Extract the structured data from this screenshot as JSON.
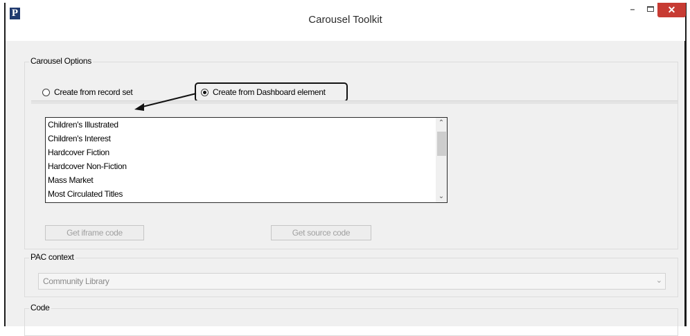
{
  "window": {
    "app_icon_letter": "P",
    "title": "Carousel Toolkit",
    "minimize_glyph": "–",
    "close_glyph": "✕"
  },
  "carousel_options": {
    "group_title": "Carousel Options",
    "radio_record_set": {
      "label": "Create from record set",
      "checked": false
    },
    "radio_dashboard": {
      "label": "Create from Dashboard element",
      "checked": true
    },
    "list_items": [
      "Children's Illustrated",
      "Children's Interest",
      "Hardcover Fiction",
      "Hardcover Non-Fiction",
      "Mass Market",
      "Most Circulated Titles"
    ],
    "get_iframe_label": "Get iframe code",
    "get_source_label": "Get source code"
  },
  "pac_context": {
    "group_title": "PAC context",
    "selected_value": "Community Library"
  },
  "code": {
    "group_title": "Code"
  },
  "colors": {
    "close_button": "#c73b33",
    "window_background": "#f0f0f0",
    "annotation": "#111111"
  }
}
